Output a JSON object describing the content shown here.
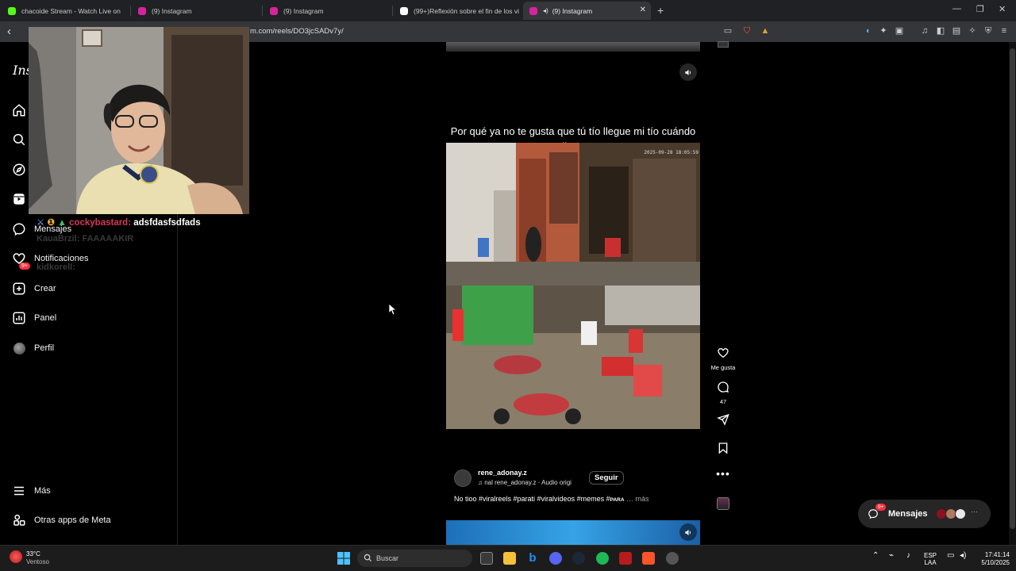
{
  "browser": {
    "tabs": [
      {
        "title": "chacoide Stream - Watch Live on",
        "favicon_color": "#53fc18",
        "active": false
      },
      {
        "title": "(9) Instagram",
        "favicon_color": "#d6249f",
        "active": false
      },
      {
        "title": "(9) Instagram",
        "favicon_color": "#d6249f",
        "active": false
      },
      {
        "title": "(99+)Reflexión sobre el fin de los vid",
        "favicon_color": "#ffffff",
        "active": false
      },
      {
        "title": "(9) Instagram",
        "favicon_color": "#d6249f",
        "active": true
      }
    ],
    "url": "m.com/reels/DO3jcSADv7y/"
  },
  "sidebar": {
    "logo": "Ins",
    "items": [
      {
        "label": "",
        "icon": "home-icon"
      },
      {
        "label": "",
        "icon": "search-icon"
      },
      {
        "label": "",
        "icon": "explore-icon"
      },
      {
        "label": "",
        "icon": "reels-icon"
      },
      {
        "label": "Mensajes",
        "icon": "messenger-icon",
        "badge": "9+"
      },
      {
        "label": "Notificaciones",
        "icon": "heart-icon"
      },
      {
        "label": "Crear",
        "icon": "plus-square-icon"
      },
      {
        "label": "Panel",
        "icon": "dashboard-icon"
      },
      {
        "label": "Perfil",
        "icon": "profile-avatar"
      },
      {
        "label": "Más",
        "icon": "menu-icon"
      },
      {
        "label": "Otras apps de Meta",
        "icon": "apps-icon"
      }
    ]
  },
  "stream_chat": {
    "user": "cockybastard:",
    "message": "adsfdasfsdfads",
    "ghost_lines": [
      "KauaBrzil: FAAAAAKIR",
      "kidkorell:"
    ]
  },
  "reel": {
    "caption": "Por qué ya no te gusta que tú tío llegue mi tío cuándo llega",
    "timestamp": "2025-09-28 18:05:59",
    "username": "rene_adonay.z",
    "audio": "nal        rene_adonay.z · Audio origi",
    "follow_label": "Seguir",
    "description": "No tioo #viralreels #parati #viralvideos #memes #",
    "description_tail": "PARA",
    "more_label": "… más",
    "actions": {
      "like_label": "Me gusta",
      "comments_count": "47"
    }
  },
  "messages_pill": {
    "label": "Mensajes",
    "badge": "9+"
  },
  "taskbar": {
    "weather_temp": "33°C",
    "weather_desc": "Ventoso",
    "search_label": "Buscar",
    "lang_top": "ESP",
    "lang_bottom": "LAA",
    "time": "17:41:14",
    "date": "5/10/2025"
  }
}
